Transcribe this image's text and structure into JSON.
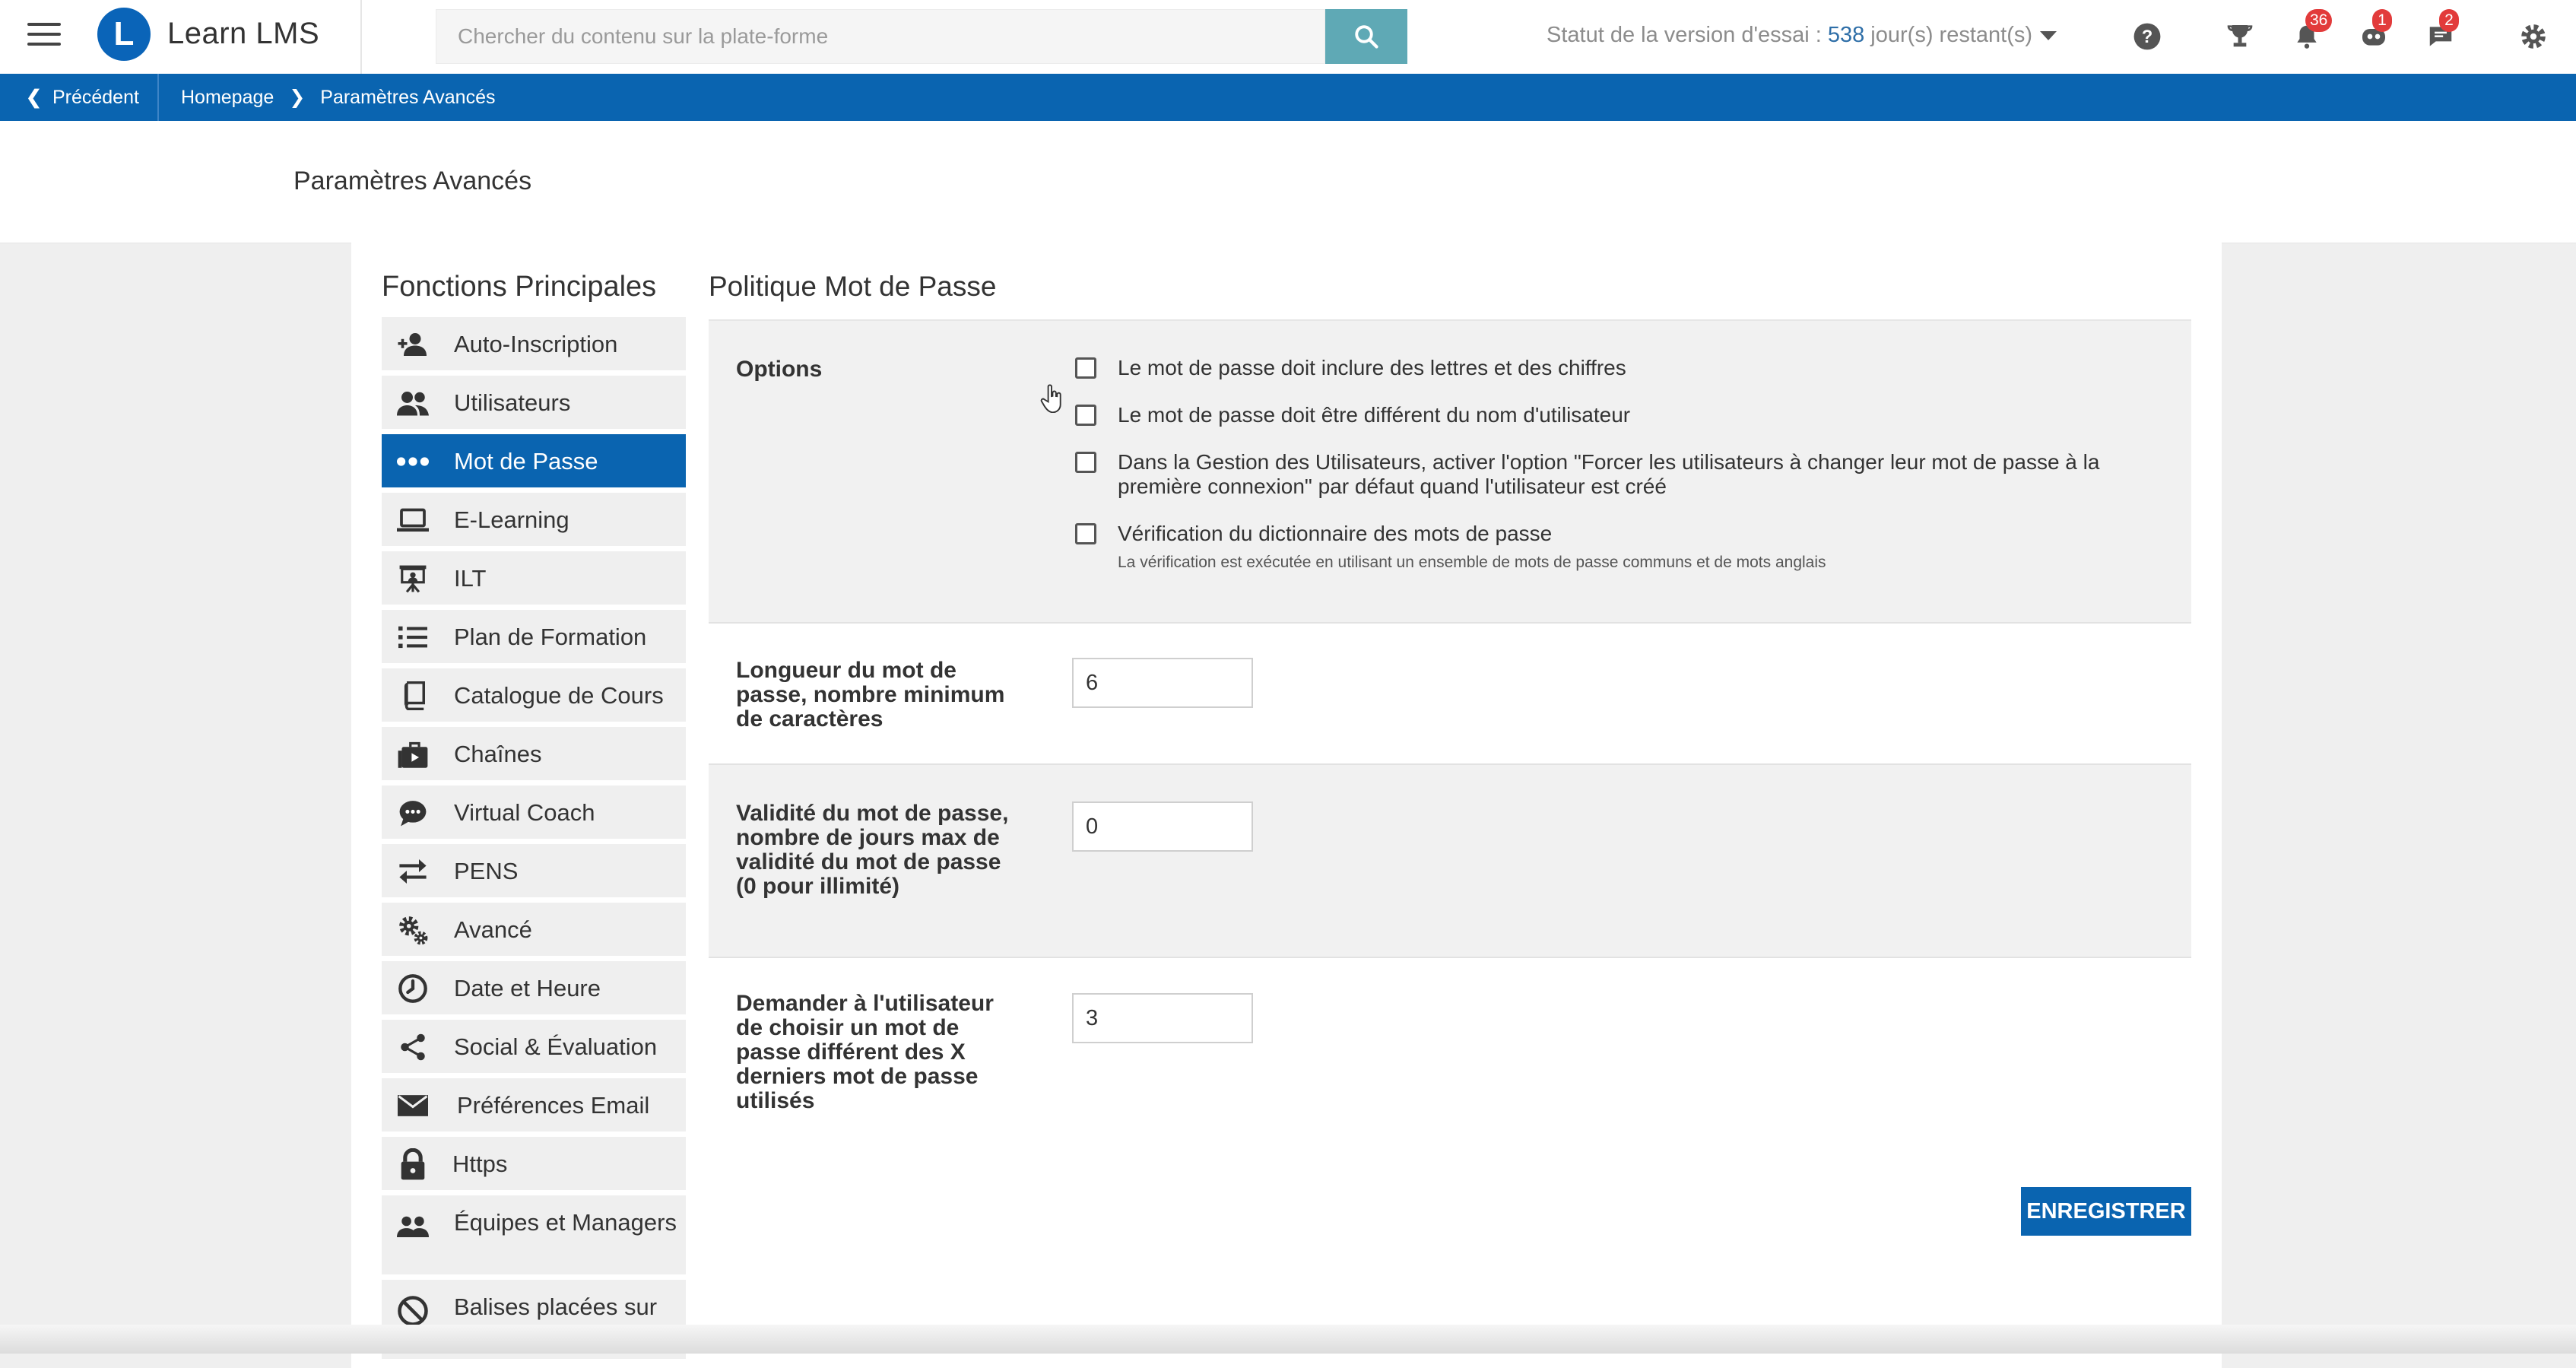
{
  "app": {
    "name": "Learn LMS",
    "logo_letter": "L"
  },
  "search": {
    "placeholder": "Chercher du contenu sur la plate-forme",
    "value": ""
  },
  "trial": {
    "prefix": "Statut de la version d'essai : ",
    "days": "538",
    "suffix": " jour(s) restant(s)"
  },
  "header_icons": {
    "notifications_count": "36",
    "assistant_count": "1",
    "messages_count": "2"
  },
  "breadcrumb": {
    "back_label": "Précédent",
    "home": "Homepage",
    "current": "Paramètres Avancés"
  },
  "page": {
    "title": "Paramètres Avancés"
  },
  "sidebar": {
    "title": "Fonctions Principales",
    "items": [
      {
        "label": "Auto-Inscription",
        "icon": "user-add-icon"
      },
      {
        "label": "Utilisateurs",
        "icon": "users-icon"
      },
      {
        "label": "Mot de Passe",
        "icon": "password-dots-icon",
        "active": true
      },
      {
        "label": "E-Learning",
        "icon": "laptop-icon"
      },
      {
        "label": "ILT",
        "icon": "presentation-icon"
      },
      {
        "label": "Plan de Formation",
        "icon": "list-icon"
      },
      {
        "label": "Catalogue de Cours",
        "icon": "book-icon"
      },
      {
        "label": "Chaînes",
        "icon": "channels-icon"
      },
      {
        "label": "Virtual Coach",
        "icon": "chat-bubble-icon"
      },
      {
        "label": "PENS",
        "icon": "arrows-exchange-icon"
      },
      {
        "label": "Avancé",
        "icon": "gears-icon"
      },
      {
        "label": "Date et Heure",
        "icon": "clock-icon"
      },
      {
        "label": "Social & Évaluation",
        "icon": "share-icon"
      },
      {
        "label": "Préférences Email",
        "icon": "envelope-icon"
      },
      {
        "label": "Https",
        "icon": "lock-icon"
      },
      {
        "label": "Équipes et Managers",
        "icon": "team-icon"
      },
      {
        "label": "Balises placées sur la liste de blocage",
        "icon": "blocked-icon"
      }
    ]
  },
  "main": {
    "title": "Politique Mot de Passe",
    "options": {
      "label": "Options",
      "items": [
        {
          "text": "Le mot de passe doit inclure des lettres et des chiffres",
          "checked": false
        },
        {
          "text": "Le mot de passe doit être différent du nom d'utilisateur",
          "checked": false
        },
        {
          "text": "Dans la Gestion des Utilisateurs, activer l'option \"Forcer les utilisateurs à changer leur mot de passe à la première connexion\" par défaut quand l'utilisateur est créé",
          "checked": false
        },
        {
          "text": "Vérification du dictionnaire des mots de passe",
          "hint": "La vérification est exécutée en utilisant un ensemble de mots de passe communs et de mots anglais",
          "checked": false
        }
      ]
    },
    "min_length": {
      "label": "Longueur du mot de passe, nombre minimum de caractères",
      "value": "6"
    },
    "validity": {
      "label": "Validité du mot de passe, nombre de jours max de validité du mot de passe (0 pour illimité)",
      "value": "0"
    },
    "history": {
      "label": "Demander à l'utilisateur de choisir un mot de passe différent des X derniers mot de passe utilisés",
      "value": "3"
    },
    "save_label": "ENREGISTRER"
  }
}
